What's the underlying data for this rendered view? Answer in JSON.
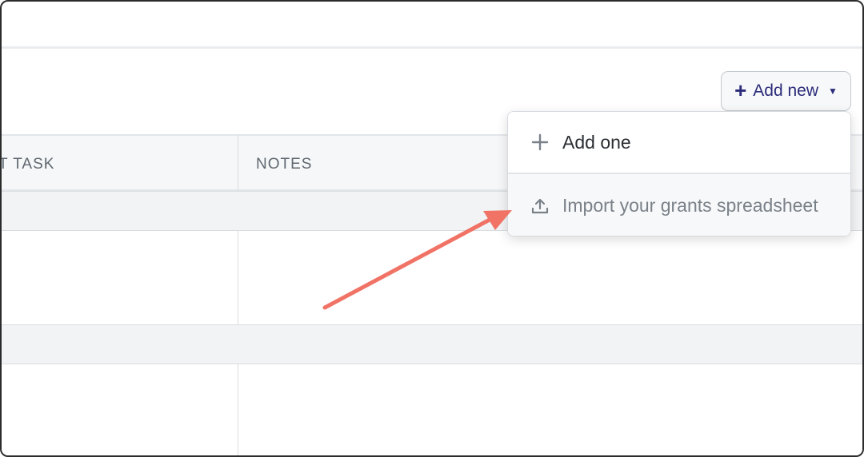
{
  "toolbar": {
    "add_new_label": "Add new"
  },
  "table": {
    "columns": [
      {
        "label": "T TASK"
      },
      {
        "label": "NOTES"
      }
    ]
  },
  "dropdown": {
    "items": [
      {
        "label": "Add one",
        "icon": "plus-icon"
      },
      {
        "label": "Import your grants spreadsheet",
        "icon": "upload-icon"
      }
    ]
  },
  "colors": {
    "accent": "#2c2c7a",
    "arrow": "#f07366"
  }
}
